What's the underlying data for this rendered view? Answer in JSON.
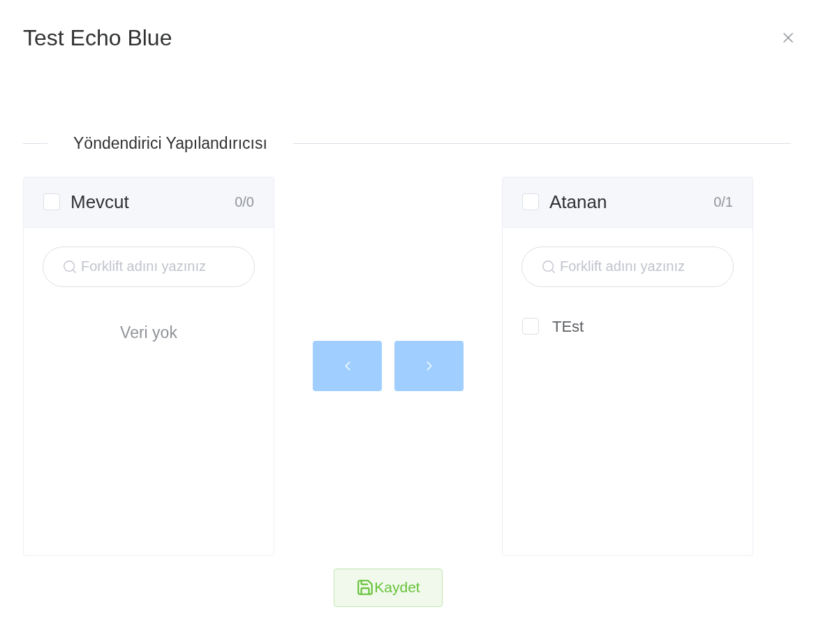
{
  "dialog": {
    "title": "Test Echo Blue"
  },
  "section_title": "Yöndendirici Yapılandırıcısı",
  "panels": [
    {
      "title": "Mevcut",
      "count": "0/0",
      "checked": false,
      "search": {
        "placeholder": "Forklift adını yazınız"
      },
      "empty_text": "Veri yok"
    },
    {
      "title": "Atanan",
      "count": "0/1",
      "checked": false,
      "search": {
        "placeholder": "Forklift adını yazınız"
      },
      "items": [
        {
          "label": "TEst",
          "checked": false
        }
      ]
    }
  ],
  "transfer_buttons": [
    {
      "kind": "left",
      "disabled": true
    },
    {
      "kind": "right",
      "disabled": true
    }
  ],
  "save_button": {
    "label": "Kaydet"
  }
}
